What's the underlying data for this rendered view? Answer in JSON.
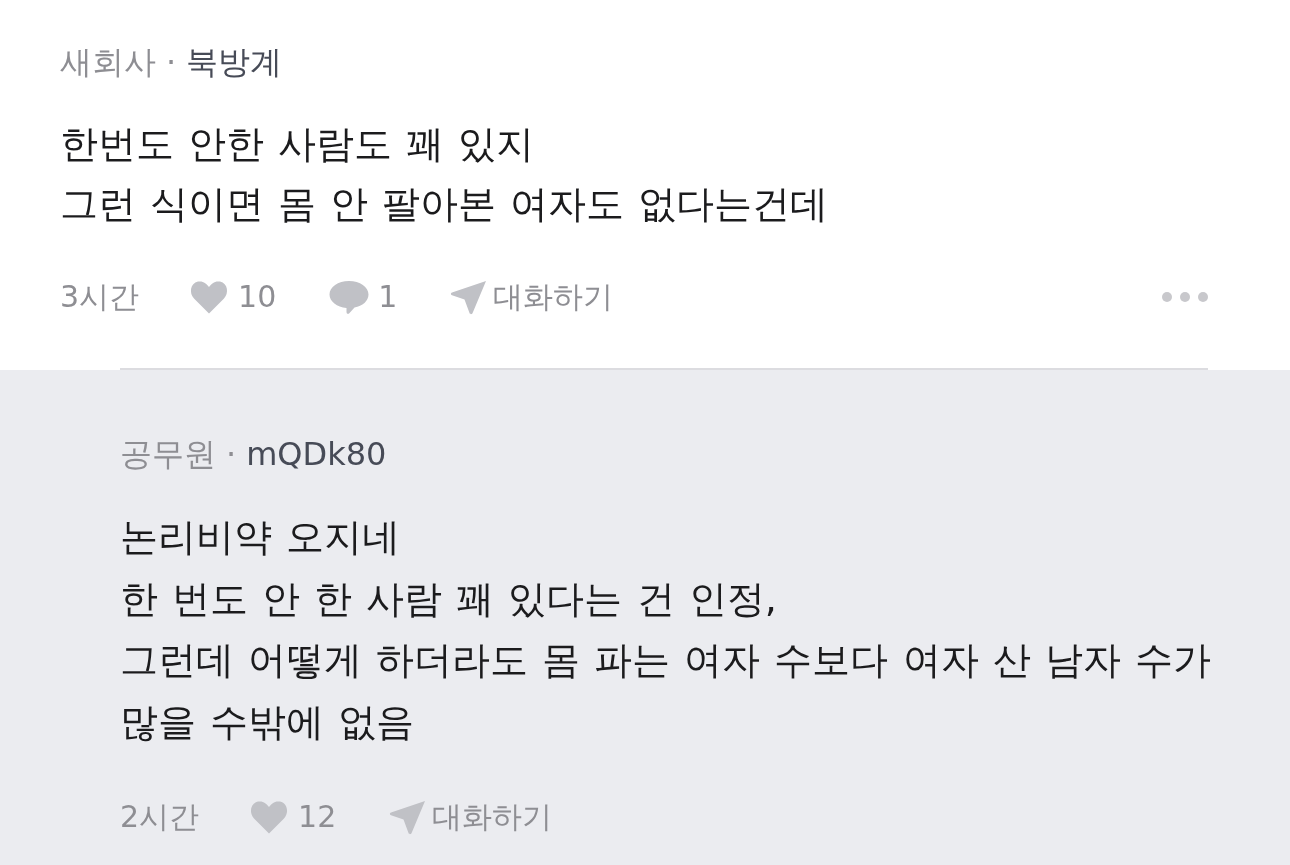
{
  "comment": {
    "company": "새회사",
    "separator": "·",
    "nickname": "북방계",
    "text": "한번도 안한 사람도 꽤 있지\n그런 식이면 몸 안 팔아본 여자도 없다는건데",
    "time": "3시간",
    "likes": "10",
    "reply_count": "1",
    "chat_label": "대화하기",
    "more_menu": true
  },
  "replies": [
    {
      "company": "공무원",
      "separator": "·",
      "nickname": "mQDk80",
      "text": "논리비약 오지네\n한 번도 안 한 사람 꽤 있다는 건 인정,\n그런데 어떻게 하더라도 몸 파는 여자 수보다 여자 산 남자 수가\n많을 수밖에 없음",
      "time": "2시간",
      "likes": "12",
      "chat_label": "대화하기",
      "more_menu": false
    }
  ]
}
